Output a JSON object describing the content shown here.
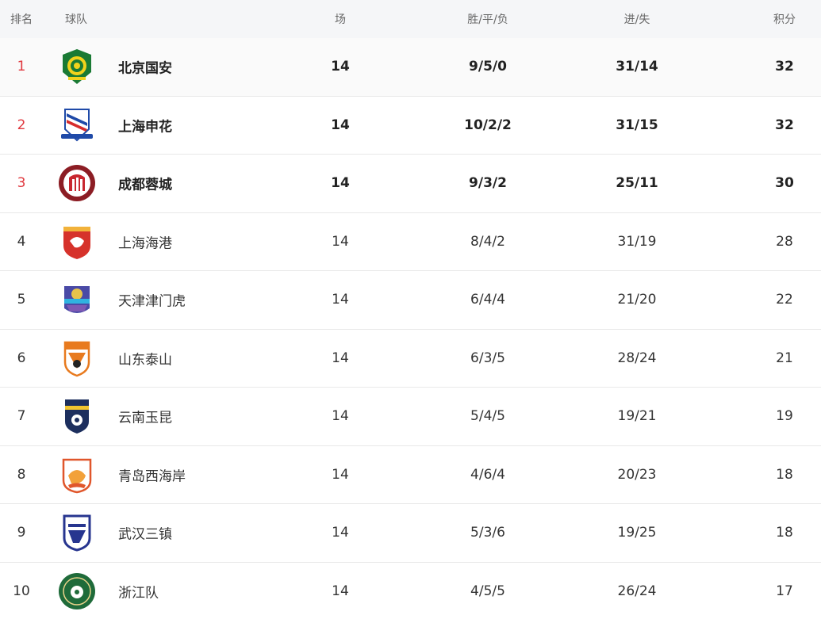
{
  "headers": {
    "rank": "排名",
    "team": "球队",
    "played": "场",
    "wdl": "胜/平/负",
    "goals": "进/失",
    "points": "积分"
  },
  "colors": {
    "rank_highlight": "#e0383e",
    "header_bg": "#f5f6f8",
    "divider": "#e8e8e8"
  },
  "rows": [
    {
      "rank": "1",
      "team": "北京国安",
      "played": "14",
      "wdl": "9/5/0",
      "goals": "31/14",
      "points": "32",
      "badge_icon": "beijing-guoan-badge-icon"
    },
    {
      "rank": "2",
      "team": "上海申花",
      "played": "14",
      "wdl": "10/2/2",
      "goals": "31/15",
      "points": "32",
      "badge_icon": "shanghai-shenhua-badge-icon"
    },
    {
      "rank": "3",
      "team": "成都蓉城",
      "played": "14",
      "wdl": "9/3/2",
      "goals": "25/11",
      "points": "30",
      "badge_icon": "chengdu-rongcheng-badge-icon"
    },
    {
      "rank": "4",
      "team": "上海海港",
      "played": "14",
      "wdl": "8/4/2",
      "goals": "31/19",
      "points": "28",
      "badge_icon": "shanghai-port-badge-icon"
    },
    {
      "rank": "5",
      "team": "天津津门虎",
      "played": "14",
      "wdl": "6/4/4",
      "goals": "21/20",
      "points": "22",
      "badge_icon": "tianjin-jinmen-tiger-badge-icon"
    },
    {
      "rank": "6",
      "team": "山东泰山",
      "played": "14",
      "wdl": "6/3/5",
      "goals": "28/24",
      "points": "21",
      "badge_icon": "shandong-taishan-badge-icon"
    },
    {
      "rank": "7",
      "team": "云南玉昆",
      "played": "14",
      "wdl": "5/4/5",
      "goals": "19/21",
      "points": "19",
      "badge_icon": "yunnan-yukun-badge-icon"
    },
    {
      "rank": "8",
      "team": "青岛西海岸",
      "played": "14",
      "wdl": "4/6/4",
      "goals": "20/23",
      "points": "18",
      "badge_icon": "qingdao-west-coast-badge-icon"
    },
    {
      "rank": "9",
      "team": "武汉三镇",
      "played": "14",
      "wdl": "5/3/6",
      "goals": "19/25",
      "points": "18",
      "badge_icon": "wuhan-three-towns-badge-icon"
    },
    {
      "rank": "10",
      "team": "浙江队",
      "played": "14",
      "wdl": "4/5/5",
      "goals": "26/24",
      "points": "17",
      "badge_icon": "zhejiang-badge-icon"
    }
  ]
}
